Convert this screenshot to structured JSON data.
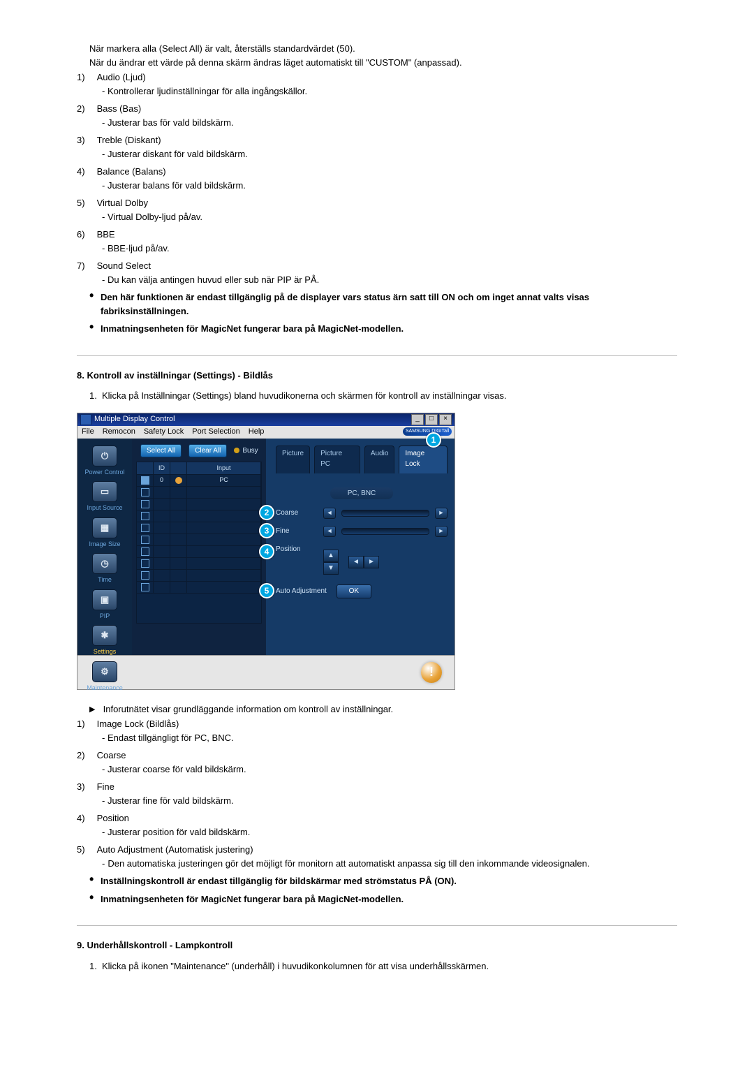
{
  "intro": {
    "line1": "När markera alla (Select All) är valt, återställs standardvärdet (50).",
    "line2": "När du ändrar ett värde på denna skärm ändras läget automatiskt till \"CUSTOM\" (anpassad)."
  },
  "audioItems": [
    {
      "num": "1)",
      "title": "Audio (Ljud)",
      "desc": "- Kontrollerar ljudinställningar för alla ingångskällor."
    },
    {
      "num": "2)",
      "title": "Bass (Bas)",
      "desc": "- Justerar bas för vald bildskärm."
    },
    {
      "num": "3)",
      "title": "Treble (Diskant)",
      "desc": "- Justerar diskant för vald bildskärm."
    },
    {
      "num": "4)",
      "title": "Balance (Balans)",
      "desc": "- Justerar balans för vald bildskärm."
    },
    {
      "num": "5)",
      "title": "Virtual Dolby",
      "desc": "- Virtual Dolby-ljud på/av."
    },
    {
      "num": "6)",
      "title": "BBE",
      "desc": "- BBE-ljud på/av."
    },
    {
      "num": "7)",
      "title": "Sound Select",
      "desc": "- Du kan välja antingen huvud eller sub när PIP är PÅ."
    }
  ],
  "audioBullets": [
    "Den här funktionen är endast tillgänglig på de displayer vars status ärn satt till ON och om inget annat valts visas fabriksinställningen.",
    "Inmatningsenheten för MagicNet fungerar bara på MagicNet-modellen."
  ],
  "section8": {
    "title": "8. Kontroll av inställningar (Settings) - Bildlås",
    "step1": "Klicka på Inställningar (Settings) bland huvudikonerna och skärmen för kontroll av inställningar visas.",
    "arrowline": "Inforutnätet visar grundläggande information om kontroll av inställningar.",
    "items": [
      {
        "num": "1)",
        "title": "Image Lock (Bildlås)",
        "desc": "- Endast tillgängligt för PC, BNC."
      },
      {
        "num": "2)",
        "title": "Coarse",
        "desc": "- Justerar coarse för vald bildskärm."
      },
      {
        "num": "3)",
        "title": "Fine",
        "desc": "- Justerar fine för vald bildskärm."
      },
      {
        "num": "4)",
        "title": "Position",
        "desc": "- Justerar position för vald bildskärm."
      },
      {
        "num": "5)",
        "title": "Auto Adjustment (Automatisk justering)",
        "desc": "Den automatiska justeringen gör det möjligt för monitorn att automatiskt anpassa sig till den inkommande videosignalen."
      }
    ],
    "bullets": [
      "Inställningskontroll är endast tillgänglig för bildskärmar med strömstatus PÅ (ON).",
      "Inmatningsenheten för MagicNet fungerar bara på MagicNet-modellen."
    ]
  },
  "section9": {
    "title": "9. Underhållskontroll - Lampkontroll",
    "step1": "Klicka på ikonen \"Maintenance\" (underhåll) i huvudikonkolumnen för att visa underhållsskärmen."
  },
  "app": {
    "title": "Multiple Display Control",
    "menu": [
      "File",
      "Remocon",
      "Safety Lock",
      "Port Selection",
      "Help"
    ],
    "brand": "SAMSUNG DIGITall",
    "winbtns": {
      "min": "_",
      "max": "□",
      "close": "×"
    },
    "selectAll": "Select All",
    "clearAll": "Clear All",
    "busy": "Busy",
    "listHeaders": [
      "",
      "ID",
      "",
      "Input"
    ],
    "rows": [
      {
        "chk": true,
        "id": "0",
        "stat": "orange",
        "input": "PC"
      }
    ],
    "emptyRows": 9,
    "sidebar": [
      {
        "label": "Power Control",
        "glyph": "⏻"
      },
      {
        "label": "Input Source",
        "glyph": "▭"
      },
      {
        "label": "Image Size",
        "glyph": "▦"
      },
      {
        "label": "Time",
        "glyph": "◷"
      },
      {
        "label": "PIP",
        "glyph": "▣"
      },
      {
        "label": "Settings",
        "glyph": "✱",
        "active": true
      },
      {
        "label": "Maintenance",
        "glyph": "⚙"
      }
    ],
    "tabs": [
      "Picture",
      "Picture PC",
      "Audio",
      "Image Lock"
    ],
    "activeTab": 3,
    "srcLabel": "PC, BNC",
    "labels": {
      "coarse": "Coarse",
      "fine": "Fine",
      "position": "Position",
      "auto": "Auto Adjustment",
      "ok": "OK"
    },
    "callouts": [
      "1",
      "2",
      "3",
      "4",
      "5"
    ],
    "orb": "!"
  }
}
